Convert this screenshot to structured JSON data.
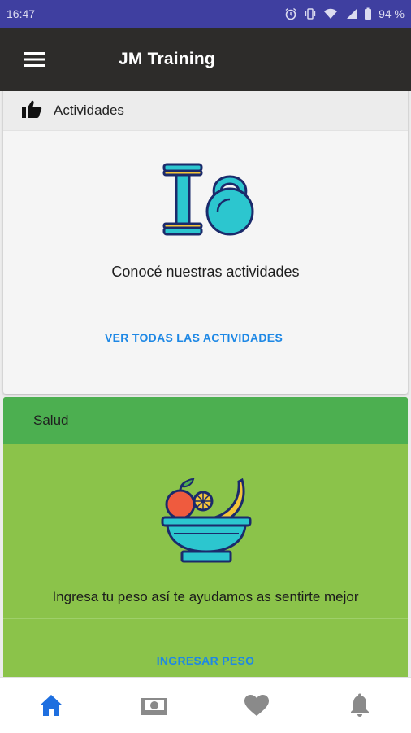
{
  "status_bar": {
    "time": "16:47",
    "battery": "94 %",
    "icons": [
      "alarm-icon",
      "vibrate-icon",
      "wifi-icon",
      "signal-icon",
      "battery-icon"
    ]
  },
  "app_bar": {
    "title": "JM Training",
    "menu_icon": "hamburger-icon"
  },
  "activities_card": {
    "header_icon": "thumbs-up-icon",
    "header_label": "Actividades",
    "illustration": "dumbbell-kettlebell-icon",
    "text": "Conocé nuestras actividades",
    "link_label": "VER TODAS LAS ACTIVIDADES"
  },
  "health_card": {
    "header_label": "Salud",
    "illustration": "fruit-bowl-icon",
    "text": "Ingresa tu peso así te ayudamos as sentirte mejor",
    "link_label": "INGRESAR PESO"
  },
  "bottom_nav": [
    {
      "icon": "home-icon",
      "active": true
    },
    {
      "icon": "money-icon",
      "active": false
    },
    {
      "icon": "heart-icon",
      "active": false
    },
    {
      "icon": "bell-icon",
      "active": false
    }
  ],
  "colors": {
    "status_bar": "#3f3fa0",
    "app_bar": "#2d2c2a",
    "accent_link": "#1e88e5",
    "health_header": "#4caf50",
    "health_body": "#8bc34a",
    "nav_active": "#1e6fe0",
    "nav_inactive": "#8a8a8a"
  }
}
